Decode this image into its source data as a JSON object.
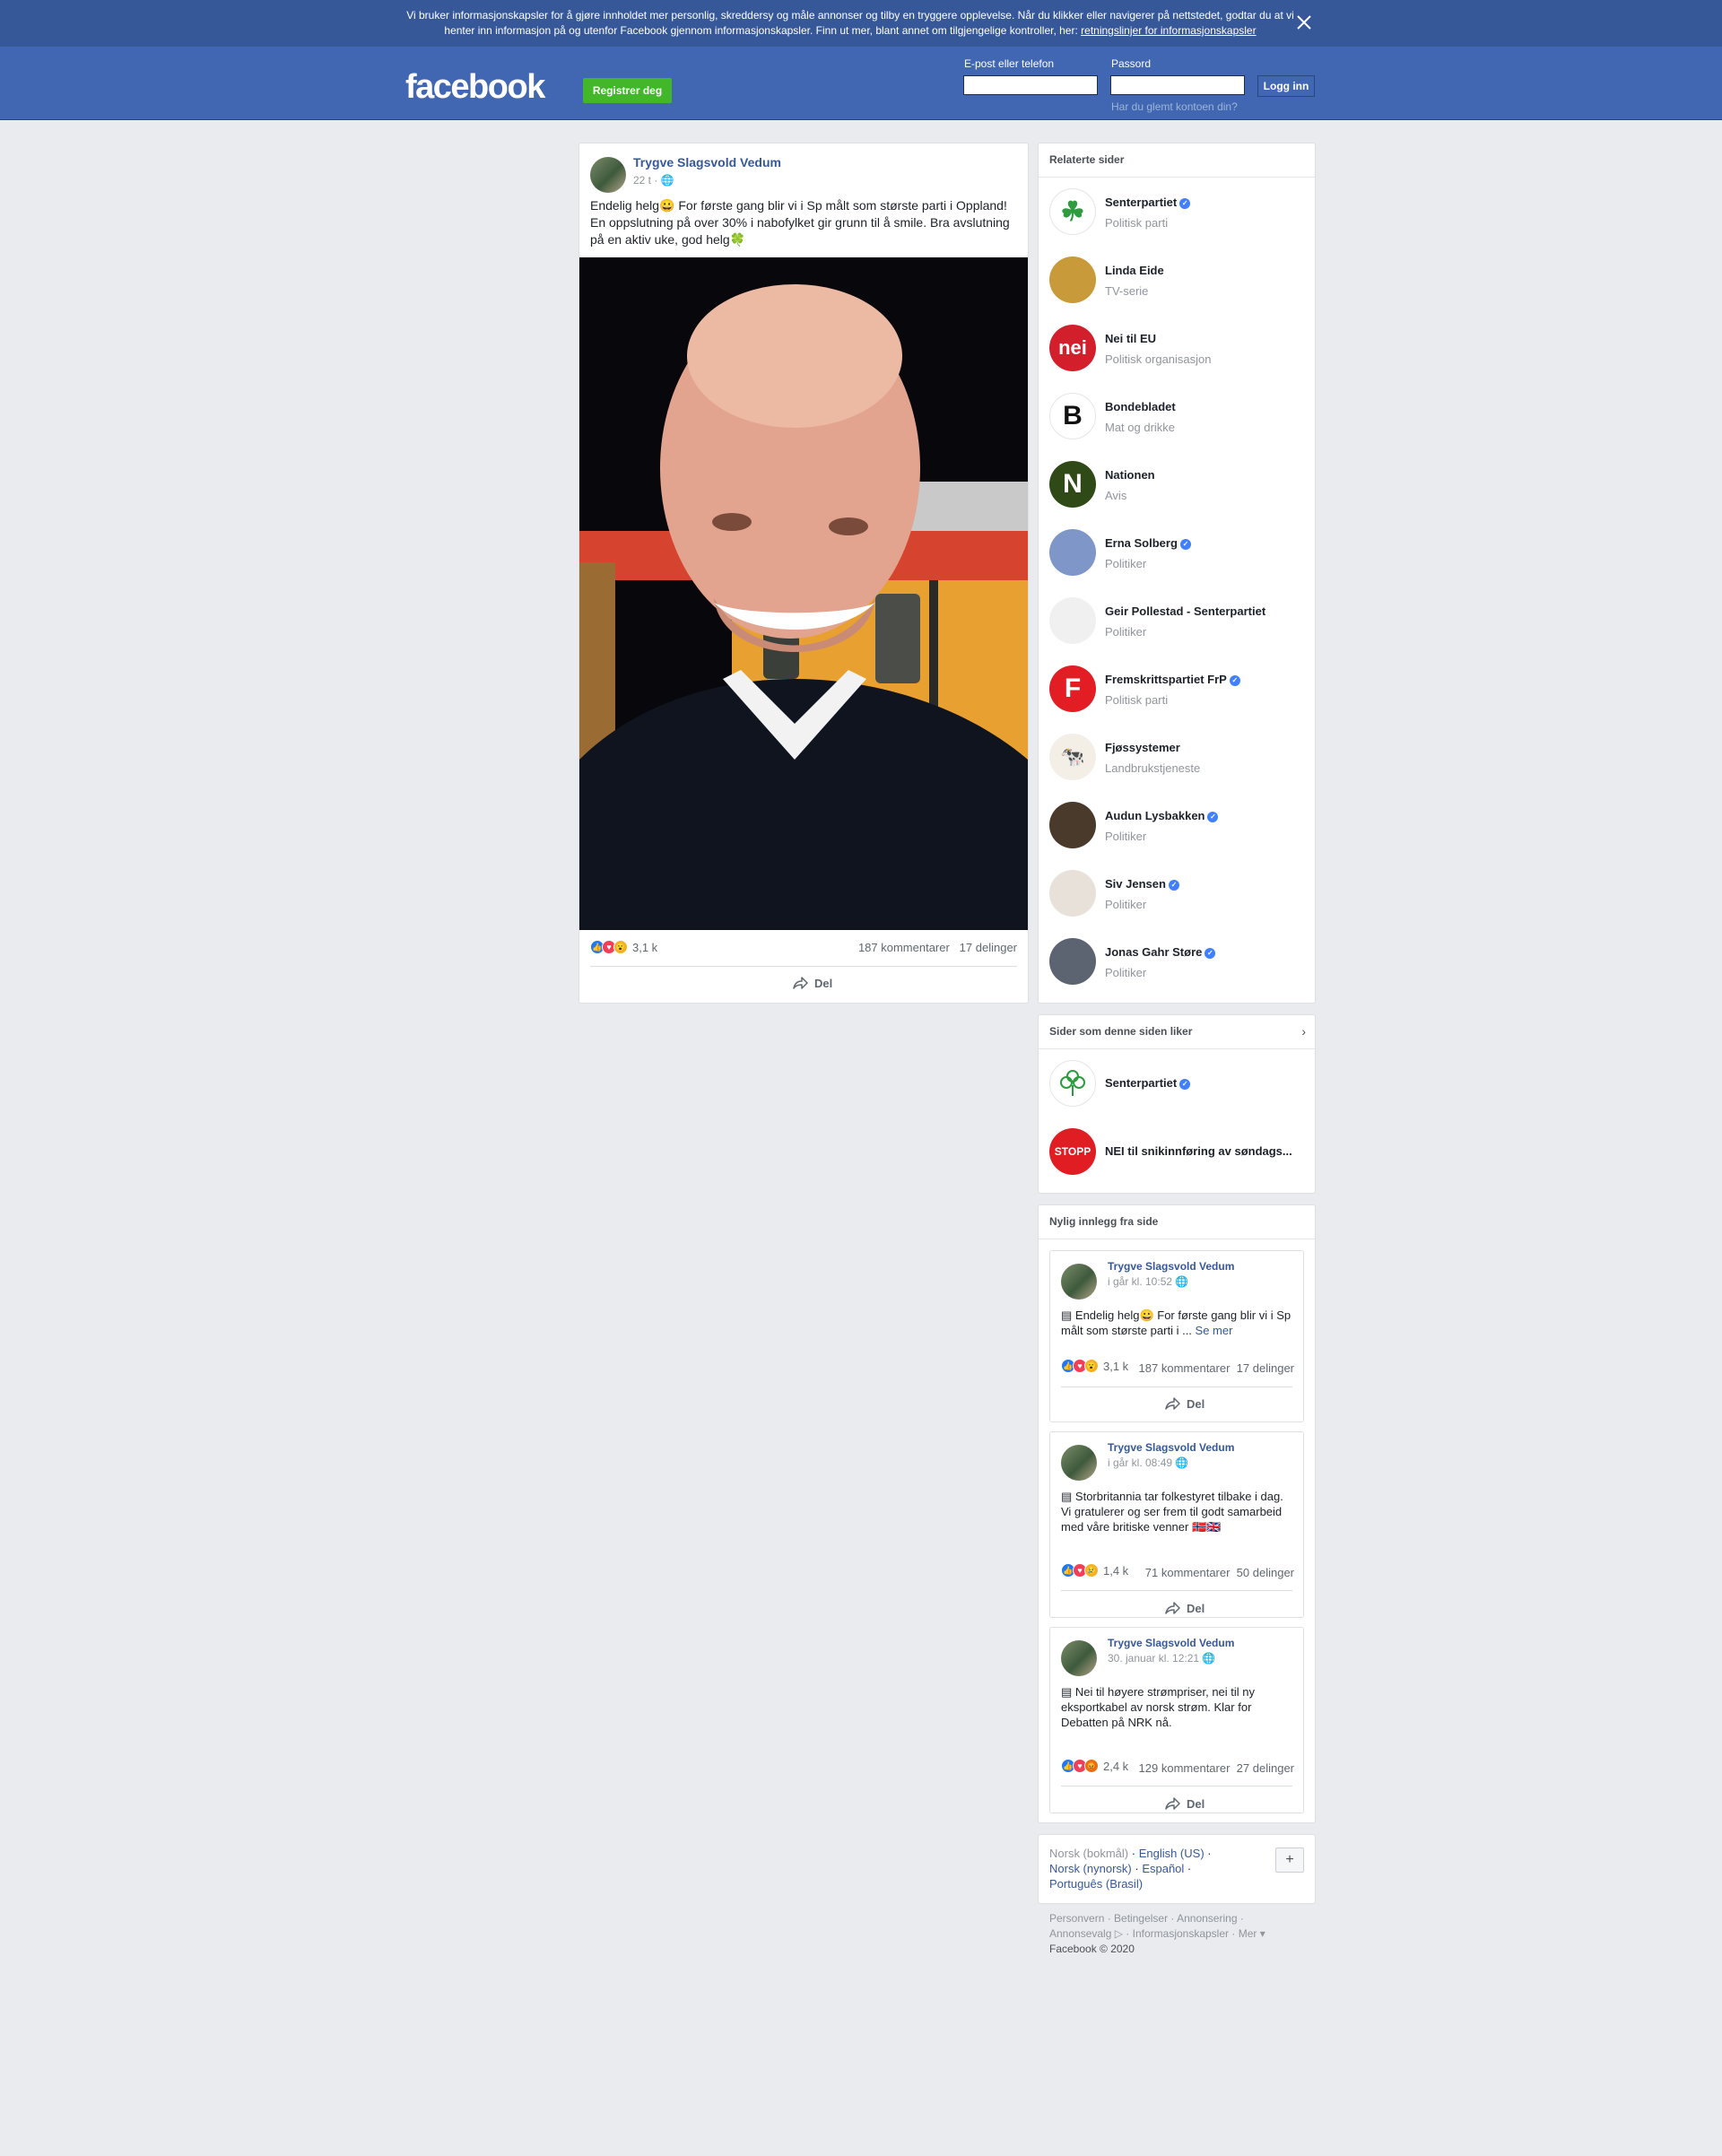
{
  "cookie_banner": {
    "text": "Vi bruker informasjonskapsler for å gjøre innholdet mer personlig, skreddersy og måle annonser og tilby en tryggere opplevelse. Når du klikker eller navigerer på nettstedet, godtar du at vi henter inn informasjon på og utenfor Facebook gjennom informasjonskapsler. Finn ut mer, blant annet om tilgjengelige kontroller, her: ",
    "link": "retningslinjer for informasjonskapsler"
  },
  "header": {
    "logo": "facebook",
    "register_label": "Registrer deg",
    "email_label": "E-post eller telefon",
    "password_label": "Passord",
    "forgot_label": "Har du glemt kontoen din?",
    "login_label": "Logg inn"
  },
  "post": {
    "author": "Trygve Slagsvold Vedum",
    "time": "22 t",
    "text": "Endelig helg😀 For første gang blir vi i Sp målt som største parti i Oppland! En oppslutning på over 30% i nabofylket gir grunn til å smile. Bra avslutning på en aktiv uke, god helg🍀",
    "reaction_count": "3,1 k",
    "comments": "187 kommentarer",
    "shares": "17 delinger",
    "share_label": "Del"
  },
  "related": {
    "title": "Relaterte sider",
    "pages": [
      {
        "name": "Senterpartiet",
        "category": "Politisk parti",
        "verified": true
      },
      {
        "name": "Linda Eide",
        "category": "TV-serie",
        "verified": false
      },
      {
        "name": "Nei til EU",
        "category": "Politisk organisasjon",
        "verified": false
      },
      {
        "name": "Bondebladet",
        "category": "Mat og drikke",
        "verified": false
      },
      {
        "name": "Nationen",
        "category": "Avis",
        "verified": false
      },
      {
        "name": "Erna Solberg",
        "category": "Politiker",
        "verified": true
      },
      {
        "name": "Geir Pollestad - Senterpartiet",
        "category": "Politiker",
        "verified": false
      },
      {
        "name": "Fremskrittspartiet FrP",
        "category": "Politisk parti",
        "verified": true
      },
      {
        "name": "Fjøssystemer",
        "category": "Landbrukstjeneste",
        "verified": false
      },
      {
        "name": "Audun Lysbakken",
        "category": "Politiker",
        "verified": true
      },
      {
        "name": "Siv Jensen",
        "category": "Politiker",
        "verified": true
      },
      {
        "name": "Jonas Gahr Støre",
        "category": "Politiker",
        "verified": true
      }
    ]
  },
  "liked_pages": {
    "title": "Sider som denne siden liker",
    "pages": [
      {
        "name": "Senterpartiet",
        "verified": true
      },
      {
        "name": "NEI til snikinnføring av søndags...",
        "verified": false
      }
    ]
  },
  "recent": {
    "title": "Nylig innlegg fra side",
    "posts": [
      {
        "author": "Trygve Slagsvold Vedum",
        "time": "i går kl. 10:52",
        "text": "Endelig helg😀 For første gang blir vi i Sp målt som største parti i ...",
        "more": "Se mer",
        "reactions": "3,1 k",
        "comments": "187 kommentarer",
        "shares": "17 delinger",
        "share_label": "Del"
      },
      {
        "author": "Trygve Slagsvold Vedum",
        "time": "i går kl. 08:49",
        "text": "Storbritannia tar folkestyret tilbake i dag. Vi gratulerer og ser frem til godt samarbeid med våre britiske venner 🇳🇴🇬🇧",
        "more": "",
        "reactions": "1,4 k",
        "comments": "71 kommentarer",
        "shares": "50 delinger",
        "share_label": "Del"
      },
      {
        "author": "Trygve Slagsvold Vedum",
        "time": "30. januar kl. 12:21",
        "text": "Nei til høyere strømpriser, nei til ny eksportkabel av norsk strøm. Klar for Debatten på NRK nå.",
        "more": "",
        "reactions": "2,4 k",
        "comments": "129 kommentarer",
        "shares": "27 delinger",
        "share_label": "Del"
      }
    ]
  },
  "languages": {
    "current": "Norsk (bokmål)",
    "others": [
      "English (US)",
      "Norsk (nynorsk)",
      "Español",
      "Português (Brasil)"
    ]
  },
  "footer": {
    "links": [
      "Personvern",
      "Betingelser",
      "Annonsering",
      "Annonsevalg",
      "Informasjonskapsler",
      "Mer"
    ],
    "copyright": "Facebook © 2020"
  }
}
